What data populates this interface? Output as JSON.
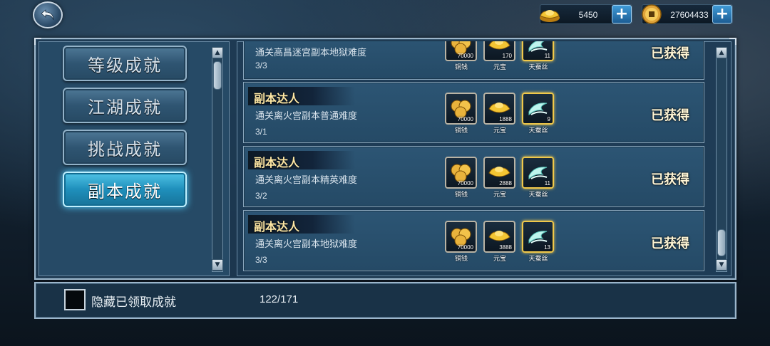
{
  "currency": {
    "gold_ingots": "5450",
    "copper_coins": "27604433"
  },
  "categories": [
    {
      "label": "等级成就",
      "active": false
    },
    {
      "label": "江湖成就",
      "active": false
    },
    {
      "label": "挑战成就",
      "active": false
    },
    {
      "label": "副本成就",
      "active": true
    }
  ],
  "achievements": [
    {
      "title": "",
      "desc": "通关高昌迷宫副本地狱难度",
      "progress": "3/3",
      "status": "已获得",
      "rewards": [
        {
          "icon": "copper-coins-icon",
          "qty": "70000",
          "name": "铜钱"
        },
        {
          "icon": "gold-ingot-icon",
          "qty": "170",
          "name": "元宝"
        },
        {
          "icon": "silkworm-silk-icon",
          "qty": "11",
          "name": "天蚕丝"
        }
      ]
    },
    {
      "title": "副本达人",
      "desc": "通关离火宫副本普通难度",
      "progress": "3/1",
      "status": "已获得",
      "rewards": [
        {
          "icon": "copper-coins-icon",
          "qty": "70000",
          "name": "铜钱"
        },
        {
          "icon": "gold-ingot-icon",
          "qty": "1888",
          "name": "元宝"
        },
        {
          "icon": "silkworm-silk-icon",
          "qty": "9",
          "name": "天蚕丝"
        }
      ]
    },
    {
      "title": "副本达人",
      "desc": "通关离火宫副本精英难度",
      "progress": "3/2",
      "status": "已获得",
      "rewards": [
        {
          "icon": "copper-coins-icon",
          "qty": "70000",
          "name": "铜钱"
        },
        {
          "icon": "gold-ingot-icon",
          "qty": "2888",
          "name": "元宝"
        },
        {
          "icon": "silkworm-silk-icon",
          "qty": "11",
          "name": "天蚕丝"
        }
      ]
    },
    {
      "title": "副本达人",
      "desc": "通关离火宫副本地狱难度",
      "progress": "3/3",
      "status": "已获得",
      "rewards": [
        {
          "icon": "copper-coins-icon",
          "qty": "70000",
          "name": "铜钱"
        },
        {
          "icon": "gold-ingot-icon",
          "qty": "3888",
          "name": "元宝"
        },
        {
          "icon": "silkworm-silk-icon",
          "qty": "13",
          "name": "天蚕丝"
        }
      ]
    }
  ],
  "footer": {
    "hide_claimed_label": "隐藏已领取成就",
    "achievement_count": "122/171"
  },
  "colors": {
    "panel": "#1d3a52",
    "accent_active": "#4fc3e6",
    "title_gold": "#ffe9a6",
    "reward_highlight": "#f0c84a"
  }
}
